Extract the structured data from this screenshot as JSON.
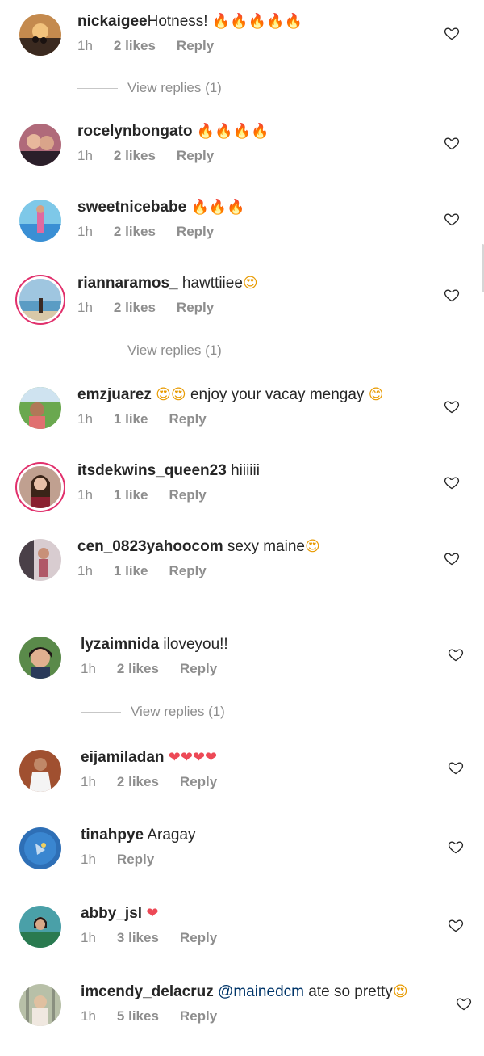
{
  "comments": [
    {
      "username": "nickaigee",
      "text": "Hotness! ",
      "emoji": "🔥🔥🔥🔥🔥",
      "time": "1h",
      "likes": "2 likes",
      "reply": "Reply"
    },
    {
      "username": "rocelynbongato",
      "text": " ",
      "emoji": "🔥🔥🔥🔥",
      "time": "1h",
      "likes": "2 likes",
      "reply": "Reply"
    },
    {
      "username": "sweetnicebabe",
      "text": " ",
      "emoji": "🔥🔥🔥",
      "time": "1h",
      "likes": "2 likes",
      "reply": "Reply"
    },
    {
      "username": "riannaramos_",
      "text": " hawttiiee",
      "emoji": "😍",
      "time": "1h",
      "likes": "2 likes",
      "reply": "Reply"
    },
    {
      "username": "emzjuarez",
      "text": " enjoy your vacay mengay ",
      "emoji_before": "😍😍",
      "emoji": "😊",
      "time": "1h",
      "likes": "1 like",
      "reply": "Reply"
    },
    {
      "username": "itsdekwins_queen23",
      "text": " hiiiiii",
      "time": "1h",
      "likes": "1 like",
      "reply": "Reply"
    },
    {
      "username": "cen_0823yahoocom",
      "text": " sexy maine",
      "emoji": "😍",
      "time": "1h",
      "likes": "1 like",
      "reply": "Reply"
    },
    {
      "username": "lyzaimnida",
      "text": " iloveyou!!",
      "time": "1h",
      "likes": "2 likes",
      "reply": "Reply"
    },
    {
      "username": "eijamiladan",
      "text": " ",
      "emoji": "❤❤❤❤",
      "time": "1h",
      "likes": "2 likes",
      "reply": "Reply"
    },
    {
      "username": "tinahpye",
      "text": " Aragay",
      "time": "1h",
      "reply": "Reply"
    },
    {
      "username": "abby_jsl",
      "text": " ",
      "emoji": "❤",
      "time": "1h",
      "likes": "3 likes",
      "reply": "Reply"
    },
    {
      "username": "imcendy_delacruz",
      "mention": "@mainedcm",
      "text": "  ate so pretty",
      "emoji": "😍",
      "time": "1h",
      "likes": "5 likes",
      "reply": "Reply"
    }
  ],
  "view_replies": "View replies (1)",
  "colors": {
    "text": "#262626",
    "meta": "#8e8e8e",
    "mention": "#003569",
    "fire": "#ff5722",
    "heart_red": "#ed4956",
    "story_ring": "#e1306c"
  },
  "icons": {
    "like": "heart-outline-icon"
  }
}
